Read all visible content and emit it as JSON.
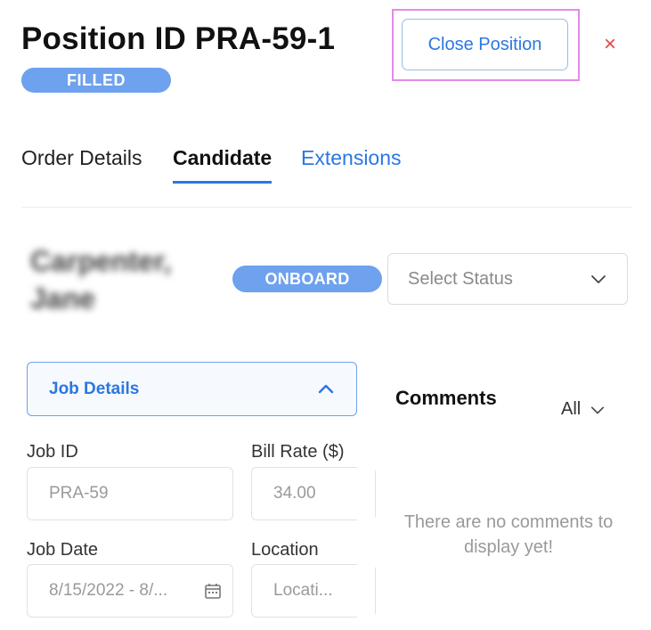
{
  "header": {
    "title": "Position ID PRA-59-1",
    "status_badge": "FILLED",
    "close_position_label": "Close Position",
    "close_icon": "×"
  },
  "tabs": [
    {
      "label": "Order Details"
    },
    {
      "label": "Candidate"
    },
    {
      "label": "Extensions"
    }
  ],
  "active_tab": "Candidate",
  "candidate": {
    "name": "Carpenter, Jane",
    "name_blurred": true,
    "stage_badge": "ONBOARD",
    "status_select_placeholder": "Select Status"
  },
  "job_details": {
    "section_label": "Job Details",
    "fields": {
      "job_id": {
        "label": "Job ID",
        "value": "PRA-59"
      },
      "bill_rate": {
        "label": "Bill Rate ($)",
        "value": "34.00"
      },
      "job_date": {
        "label": "Job Date",
        "value": "8/15/2022 - 8/..."
      },
      "location": {
        "label": "Location",
        "value": "Locati..."
      }
    }
  },
  "comments": {
    "title": "Comments",
    "filter_value": "All",
    "empty_message": "There are no comments to display yet!"
  },
  "colors": {
    "accent": "#2b77e0",
    "badge": "#6ea1ee",
    "danger": "#e04848",
    "highlight": "#e58ae8"
  },
  "icons": [
    "close-icon",
    "chevron-down-icon",
    "chevron-up-icon",
    "calendar-icon"
  ]
}
